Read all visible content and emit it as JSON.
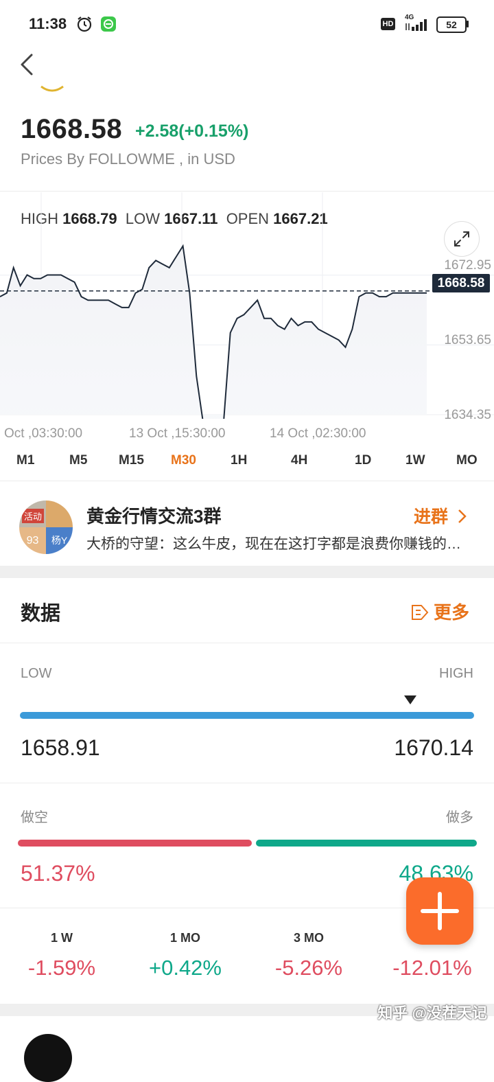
{
  "status_bar": {
    "time": "11:38",
    "hd": "HD",
    "network": "4G",
    "battery": "52"
  },
  "quote": {
    "price": "1668.58",
    "change": "+2.58(+0.15%)",
    "source": "Prices By FOLLOWME , in USD"
  },
  "chart": {
    "high_label": "HIGH",
    "high": "1668.79",
    "low_label": "LOW",
    "low": "1667.11",
    "open_label": "OPEN",
    "open": "1667.21",
    "current_price": "1668.58",
    "y_ticks": [
      "1672.95",
      "1653.65",
      "1634.35"
    ],
    "x_ticks": [
      "Oct ,03:30:00",
      "13 Oct ,15:30:00",
      "14 Oct ,02:30:00"
    ],
    "timeframes": [
      "M1",
      "M5",
      "M15",
      "M30",
      "1H",
      "4H",
      "1D",
      "1W",
      "MO"
    ],
    "active_timeframe": "M30",
    "colors": {
      "line": "#1e2a3a",
      "up": "#18a06a",
      "active_tab": "#e8731a"
    }
  },
  "chart_data": {
    "type": "line",
    "x": [
      0,
      1,
      2,
      3,
      4,
      5,
      6,
      7,
      8,
      9,
      10,
      11,
      12,
      13,
      14,
      15,
      16,
      17,
      18,
      19,
      20,
      21,
      22,
      23,
      24,
      25,
      26,
      27,
      28,
      29,
      30,
      31,
      32,
      33,
      34,
      35,
      36,
      37,
      38,
      39,
      40,
      41,
      42,
      43,
      44,
      45,
      46,
      47,
      48,
      49,
      50,
      51,
      52,
      53,
      54,
      55,
      56,
      57,
      58,
      59,
      60,
      61,
      62,
      63
    ],
    "series": [
      {
        "values": [
          1667,
          1668,
          1675,
          1670,
          1673,
          1672,
          1672,
          1673,
          1673,
          1673,
          1672,
          1671,
          1667,
          1666,
          1666,
          1666,
          1666,
          1665,
          1664,
          1664,
          1668,
          1669,
          1675,
          1677,
          1676,
          1675,
          1678,
          1681,
          1668,
          1645,
          1632,
          1630,
          1629,
          1632,
          1657,
          1661,
          1662,
          1664,
          1666,
          1661,
          1661,
          1659,
          1658,
          1661,
          1659,
          1660,
          1660,
          1658,
          1657,
          1656,
          1655,
          1653,
          1658,
          1667,
          1668,
          1668,
          1667,
          1667,
          1668,
          1668,
          1668,
          1668,
          1668,
          1668
        ]
      }
    ],
    "ylim": [
      1634.35,
      1686
    ],
    "y_ticks": [
      1672.95,
      1653.65,
      1634.35
    ],
    "x_tick_labels": [
      "Oct ,03:30:00",
      "13 Oct ,15:30:00",
      "14 Oct ,02:30:00"
    ],
    "reference_line": 1668.58,
    "grid": true
  },
  "group": {
    "avatar_tags": [
      "活动",
      "93",
      "杨Y"
    ],
    "name": "黄金行情交流3群",
    "last_message": "大桥的守望：这么牛皮，现在在这打字都是浪费你赚钱的…",
    "join": "进群"
  },
  "data_section": {
    "title": "数据",
    "more": "更多",
    "low_label": "LOW",
    "high_label": "HIGH",
    "low_value": "1658.91",
    "high_value": "1670.14",
    "range_position": 0.86,
    "short_label": "做空",
    "long_label": "做多",
    "short_pct": "51.37%",
    "long_pct": "48.63%",
    "short_ratio": 0.5137,
    "performance": [
      {
        "label": "1 W",
        "value": "-1.59%"
      },
      {
        "label": "1 MO",
        "value": "+0.42%"
      },
      {
        "label": "3 MO",
        "value": "-5.26%"
      },
      {
        "label": "",
        "value": "-12.01%"
      }
    ],
    "colors": {
      "short": "#df4d60",
      "long": "#0fa88a",
      "range": "#3b9ad9",
      "fab": "#fb6c2b"
    }
  },
  "watermark": "知乎 @没茬天记"
}
